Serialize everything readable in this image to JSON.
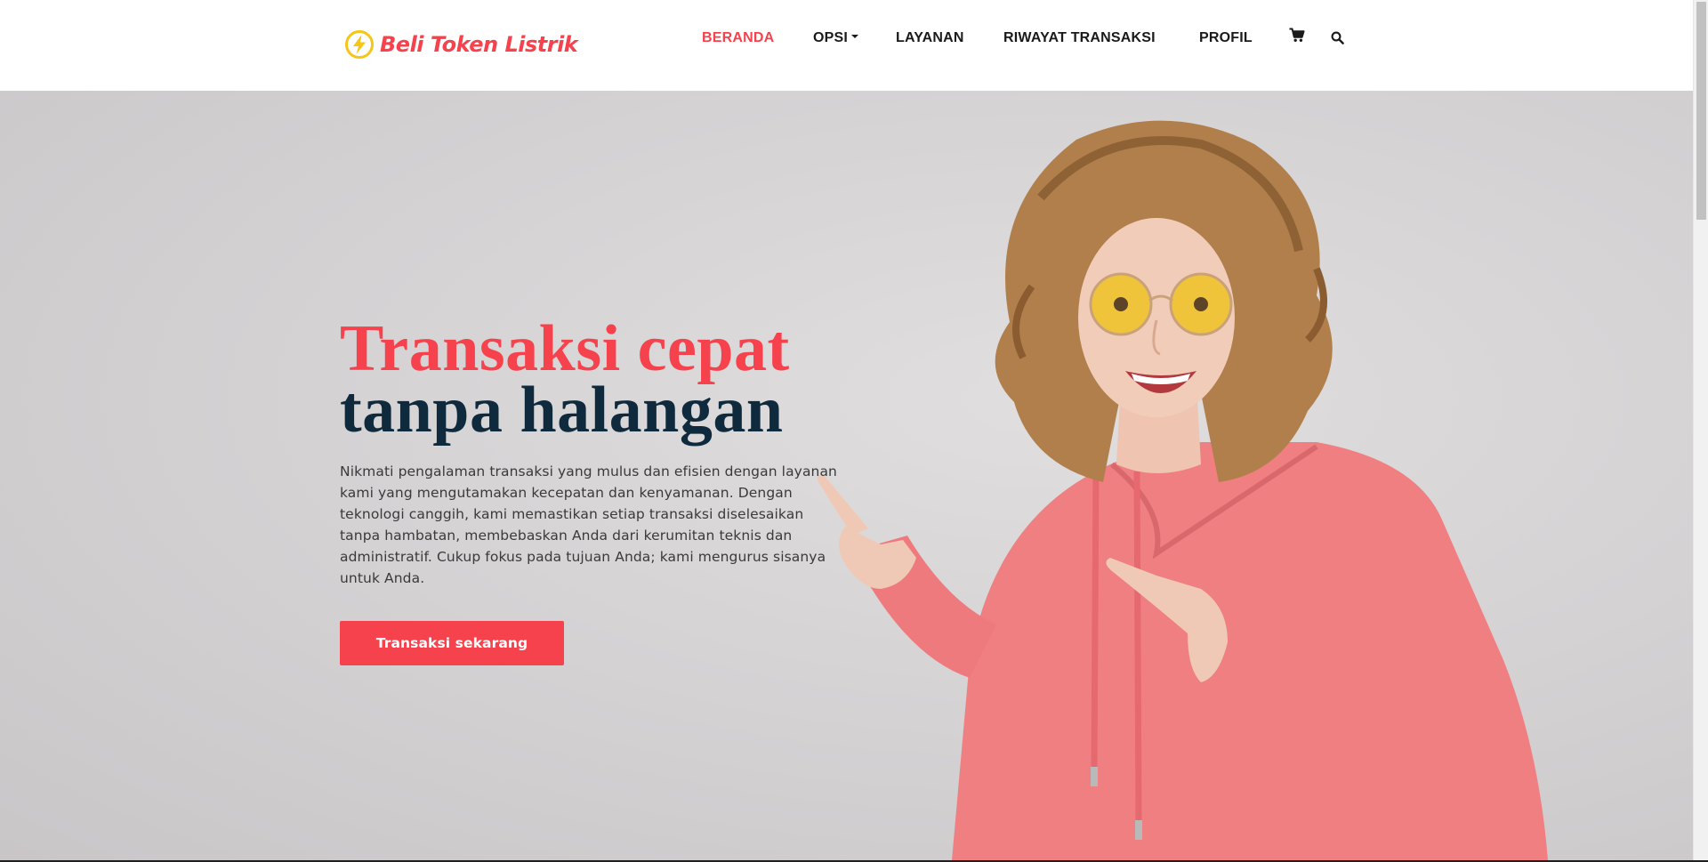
{
  "brand": {
    "name": "Beli Token Listrik",
    "logo_icon": "lightning-bolt-icon",
    "accent_color": "#f5424d",
    "logo_yellow": "#f5c518"
  },
  "nav": {
    "items": [
      {
        "label": "BERANDA",
        "active": true
      },
      {
        "label": "OPSI",
        "dropdown": true
      },
      {
        "label": "LAYANAN"
      },
      {
        "label": "RIWAYAT TRANSAKSI"
      },
      {
        "label": "PROFIL"
      }
    ],
    "icons": [
      "cart-icon",
      "search-icon"
    ]
  },
  "hero": {
    "title_line1": "Transaksi cepat",
    "title_line2": "tanpa halangan",
    "title_line1_color": "#f5424d",
    "title_line2_color": "#0f2a3d",
    "description": "Nikmati pengalaman transaksi yang mulus dan efisien dengan layanan kami yang mengutamakan kecepatan dan kenyamanan. Dengan teknologi canggih, kami memastikan setiap transaksi diselesaikan tanpa hambatan, membebaskan Anda dari kerumitan teknis dan administratif. Cukup fokus pada tujuan Anda; kami mengurus sisanya untuk Anda.",
    "cta_label": "Transaksi sekarang",
    "image": "woman-in-pink-hoodie-pointing"
  }
}
